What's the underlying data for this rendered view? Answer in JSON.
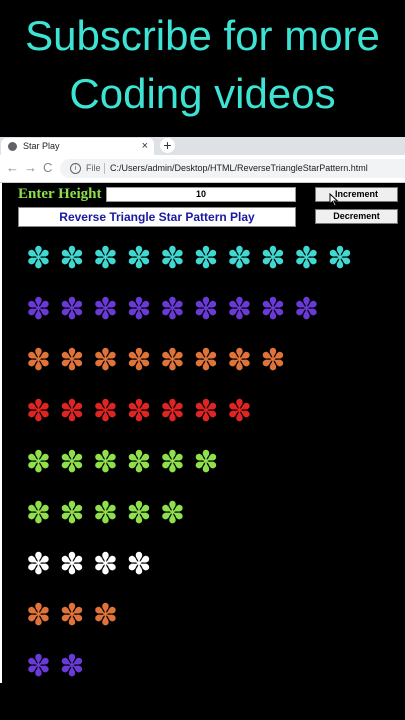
{
  "banner": {
    "line1": "Subscribe for more",
    "line2": "Coding videos"
  },
  "browser": {
    "tab_title": "Star Play",
    "tab_close": "×",
    "new_tab": "+",
    "back": "←",
    "forward": "→",
    "reload": "C",
    "info": "i",
    "file_label": "File",
    "url": "C:/Users/admin/Desktop/HTML/ReverseTriangleStarPattern.html"
  },
  "controls": {
    "height_label": "Enter Height",
    "height_value": "10",
    "increment_label": "Increment",
    "decrement_label": "Decrement",
    "title": "Reverse Triangle Star Pattern Play"
  },
  "pattern": {
    "star_glyph": "✽",
    "rows": [
      {
        "count": 10,
        "color": "#40d8d0"
      },
      {
        "count": 9,
        "color": "#6a3ad8"
      },
      {
        "count": 8,
        "color": "#e0733a"
      },
      {
        "count": 7,
        "color": "#e02323"
      },
      {
        "count": 6,
        "color": "#8fe04d"
      },
      {
        "count": 5,
        "color": "#8fe04d"
      },
      {
        "count": 4,
        "color": "#ffffff"
      },
      {
        "count": 3,
        "color": "#e0733a"
      },
      {
        "count": 2,
        "color": "#6a3ad8"
      }
    ]
  }
}
